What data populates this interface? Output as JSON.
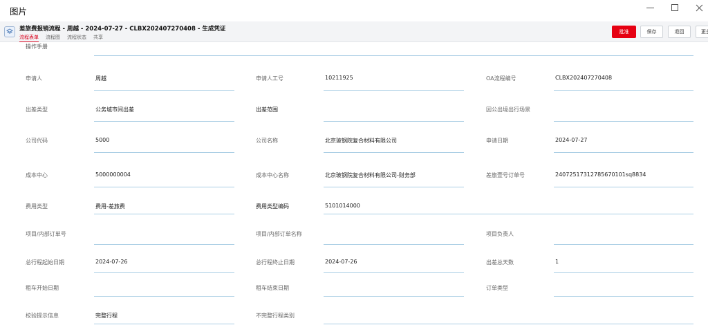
{
  "window": {
    "title": "图片"
  },
  "header": {
    "title": "差旅费报销流程 - 周越  - 2024-07-27  -  CLBX202407270408  - 生成凭证",
    "tabs": [
      {
        "label": "流程表单"
      },
      {
        "label": "流程图"
      },
      {
        "label": "流程状态"
      },
      {
        "label": "共享"
      }
    ],
    "buttons": {
      "approve": "批准",
      "save": "保存",
      "back": "退回",
      "more": "更多"
    }
  },
  "form": {
    "partial_label": "操作手册",
    "rows": [
      [
        {
          "label": "申请人",
          "value": "周越"
        },
        {
          "label": "申请人工号",
          "value": "10211925"
        },
        {
          "label": "OA流程编号",
          "value": "CLBX202407270408"
        }
      ],
      [
        {
          "label": "出差类型",
          "value": "公务城市间出差"
        },
        {
          "label": "出差范围",
          "value": ""
        },
        {
          "label": "因公出境出行场景",
          "value": ""
        }
      ],
      [
        {
          "label": "公司代码",
          "value": "5000"
        },
        {
          "label": "公司名称",
          "value": "北京玻钢院复合材料有限公司"
        },
        {
          "label": "申请日期",
          "value": "2024-07-27"
        }
      ],
      [
        {
          "label": "成本中心",
          "value": "5000000004"
        },
        {
          "label": "成本中心名称",
          "value": "北京玻钢院复合材料有限公司-财务部"
        },
        {
          "label": "差旅壹号订单号",
          "value": "24072517312785670101sq8834"
        }
      ],
      [
        {
          "label": "费用类型",
          "value": "费用-差旅费"
        },
        {
          "label": "费用类型编码",
          "value": "5101014000"
        }
      ],
      [
        {
          "label": "项目/内部订单号",
          "value": ""
        },
        {
          "label": "项目/内部订单名称",
          "value": ""
        },
        {
          "label": "项目负责人",
          "value": ""
        }
      ],
      [
        {
          "label": "总行程起始日期",
          "value": "2024-07-26"
        },
        {
          "label": "总行程终止日期",
          "value": "2024-07-26"
        },
        {
          "label": "出差总天数",
          "value": "1"
        }
      ],
      [
        {
          "label": "租车开始日期",
          "value": ""
        },
        {
          "label": "租车结束日期",
          "value": ""
        },
        {
          "label": "订单类型",
          "value": ""
        }
      ],
      [
        {
          "label": "校验提示信息",
          "value": "完整行程"
        },
        {
          "label": "不完整行程类别",
          "value": ""
        }
      ]
    ]
  }
}
